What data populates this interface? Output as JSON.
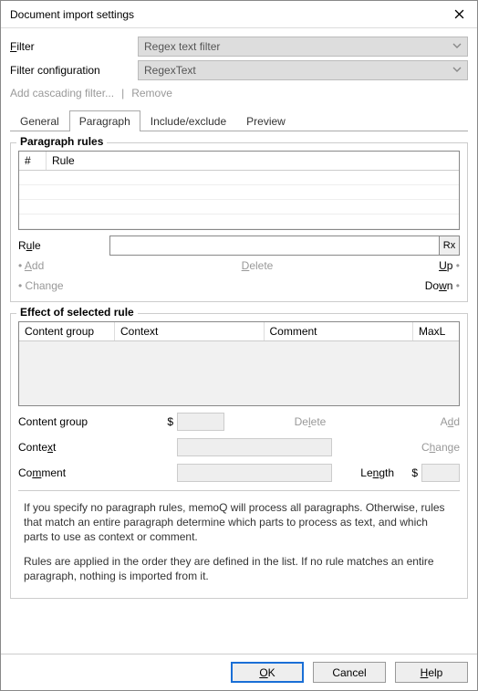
{
  "title": "Document import settings",
  "filter": {
    "label": "Filter",
    "value": "Regex text filter",
    "config_label": "Filter configuration",
    "config_value": "RegexText",
    "add_cascading": "Add cascading filter...",
    "remove": "Remove"
  },
  "tabs": {
    "general": "General",
    "paragraph": "Paragraph",
    "include_exclude": "Include/exclude",
    "preview": "Preview"
  },
  "para_rules": {
    "legend": "Paragraph rules",
    "col_num": "#",
    "col_rule": "Rule",
    "rule_label": "Rule",
    "rx_btn": "Rx",
    "add": "Add",
    "delete": "Delete",
    "up": "Up",
    "change": "Change",
    "down": "Down"
  },
  "effect": {
    "legend": "Effect of selected rule",
    "col_cg": "Content group",
    "col_ctx": "Context",
    "col_comment": "Comment",
    "col_maxl": "MaxL",
    "cg_label": "Content group",
    "dollar": "$",
    "delete": "Delete",
    "add": "Add",
    "ctx_label": "Context",
    "change": "Change",
    "comment_label": "Comment",
    "length_label": "Length"
  },
  "help": {
    "p1": "If you specify no paragraph rules, memoQ will process all paragraphs. Otherwise, rules that match an entire paragraph determine which parts to process as text, and which parts to use as context or comment.",
    "p2": "Rules are applied in the order they are defined in the list. If no rule matches an entire paragraph, nothing is imported from it."
  },
  "footer": {
    "ok": "OK",
    "cancel": "Cancel",
    "help": "Help"
  }
}
